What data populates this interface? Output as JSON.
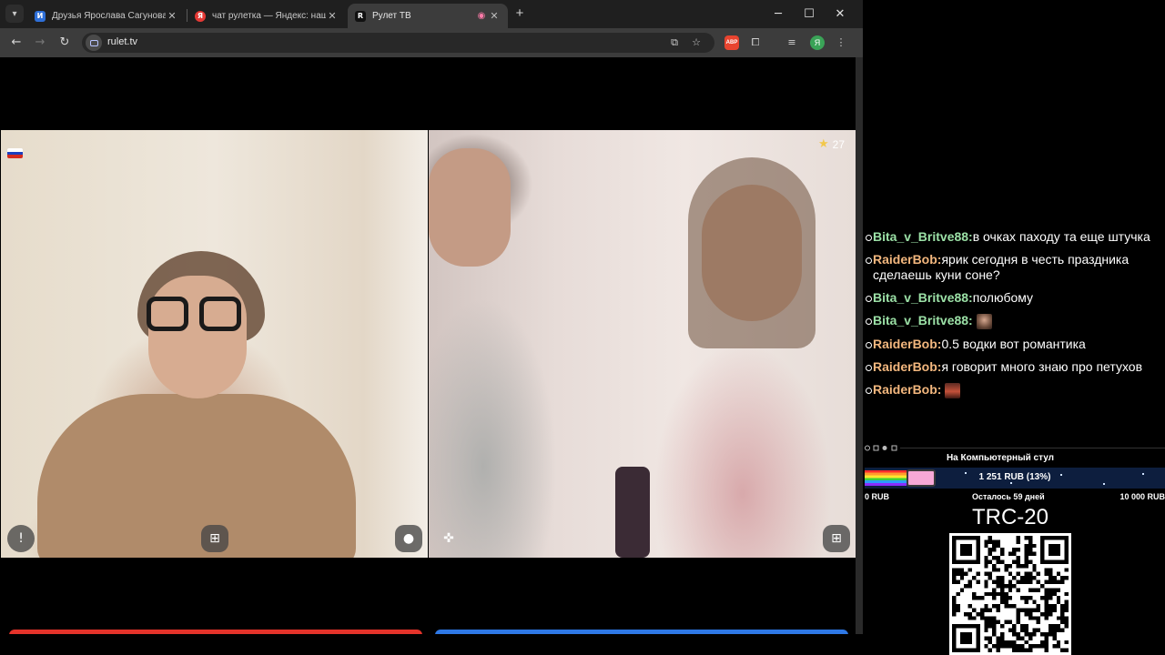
{
  "tabs": [
    {
      "title": "Друзья Ярослава Сагунова – З",
      "favicon": "vk-icon",
      "color": "#2e6fd8",
      "glyph": "И"
    },
    {
      "title": "чат рулетка — Яндекс: нашлоc",
      "favicon": "yandex-icon",
      "color": "#e53935",
      "glyph": "Я"
    },
    {
      "title": "Рулет ТВ",
      "favicon": "rulet-icon",
      "color": "#111111",
      "glyph": "R"
    }
  ],
  "toolbar": {
    "url": "rulet.tv",
    "profile_initial": "Я",
    "abp_label": "ABP"
  },
  "video": {
    "remote_counter": "27",
    "local_country_flag": [
      "#ffffff",
      "#1c3fbf",
      "#d52b1e"
    ]
  },
  "chat": [
    {
      "nick": "Bita_v_Britve88:",
      "color": "c1",
      "text": "в очках паходу та еще штучка",
      "emote": ""
    },
    {
      "nick": "RaiderBob:",
      "color": "c2",
      "text": "ярик сегодня в честь праздника сделаешь куни соне?",
      "emote": ""
    },
    {
      "nick": "Bita_v_Britve88:",
      "color": "c1",
      "text": "полюбому",
      "emote": ""
    },
    {
      "nick": "Bita_v_Britve88:",
      "color": "c1",
      "text": " ",
      "emote": "e1"
    },
    {
      "nick": "RaiderBob:",
      "color": "c2",
      "text": "0.5 водки вот романтика",
      "emote": ""
    },
    {
      "nick": "RaiderBob:",
      "color": "c2",
      "text": "я говорит много знаю про петухов",
      "emote": ""
    },
    {
      "nick": "RaiderBob:",
      "color": "c2",
      "text": " ",
      "emote": "e2"
    }
  ],
  "goal": {
    "title": "На Компьютерный стул",
    "amount_text": "1 251 RUB (13%)",
    "progress_fraction": 0.13,
    "min_label": "0 RUB",
    "remaining_label": "Осталось 59 дней",
    "max_label": "10 000 RUB"
  },
  "donate": {
    "network": "TRC-20"
  }
}
